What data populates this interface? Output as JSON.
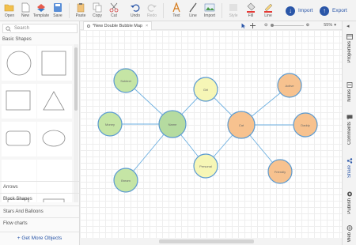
{
  "toolbar": {
    "buttons": [
      {
        "key": "open",
        "label": "Open",
        "icon": "folder-open-icon"
      },
      {
        "key": "new",
        "label": "New",
        "icon": "new-file-icon"
      },
      {
        "key": "template",
        "label": "Template",
        "icon": "template-icon"
      },
      {
        "key": "save",
        "label": "Save",
        "icon": "save-icon"
      },
      {
        "key": "paste",
        "label": "Paste",
        "icon": "paste-icon"
      },
      {
        "key": "copy",
        "label": "Copy",
        "icon": "copy-icon"
      },
      {
        "key": "cut",
        "label": "Cut",
        "icon": "scissors-icon"
      },
      {
        "key": "undo",
        "label": "Undo",
        "icon": "undo-icon"
      },
      {
        "key": "redo",
        "label": "Redo",
        "icon": "redo-icon"
      },
      {
        "key": "text",
        "label": "Text",
        "icon": "text-icon"
      },
      {
        "key": "line",
        "label": "Line",
        "icon": "line-icon"
      },
      {
        "key": "import_img",
        "label": "Import",
        "icon": "image-icon"
      },
      {
        "key": "style",
        "label": "Style",
        "icon": "style-icon"
      },
      {
        "key": "fill",
        "label": "Fill",
        "icon": "fill-bucket-icon"
      },
      {
        "key": "line_color",
        "label": "Line",
        "icon": "line-color-icon"
      }
    ],
    "import_label": "Import",
    "export_label": "Export"
  },
  "left_panel": {
    "search_placeholder": "Search",
    "section_title": "Basic Shapes",
    "categories": [
      "Arrows",
      "Block Shapes",
      "Stars And Balloons",
      "Flow charts"
    ],
    "get_more": "+ Get More Objects"
  },
  "tab": {
    "title": "*New Double Bubble Map",
    "close": "×"
  },
  "zoom": {
    "percent": "55%"
  },
  "right_tabs": [
    "Properties",
    "Notes",
    "Comments",
    "Share",
    "Publish",
    "Web"
  ],
  "colors": {
    "green_fill": "#c5e5a5",
    "green_stroke": "#5a9ad1",
    "yellow_fill": "#f6f6b6",
    "orange_fill": "#f7c28f",
    "connector": "#6aaee0",
    "accent": "#2a56a8"
  },
  "diagram": {
    "center_left": {
      "label": "Name"
    },
    "center_right": {
      "label": "Cat"
    },
    "left_nodes": [
      {
        "label": "Subtext"
      },
      {
        "label": "Money"
      },
      {
        "label": "Bream"
      }
    ],
    "shared_nodes": [
      {
        "label": "Girl"
      },
      {
        "label": "Personal"
      }
    ],
    "right_nodes": [
      {
        "label": "Active"
      },
      {
        "label": "Daddy"
      },
      {
        "label": "Friendly"
      }
    ]
  }
}
